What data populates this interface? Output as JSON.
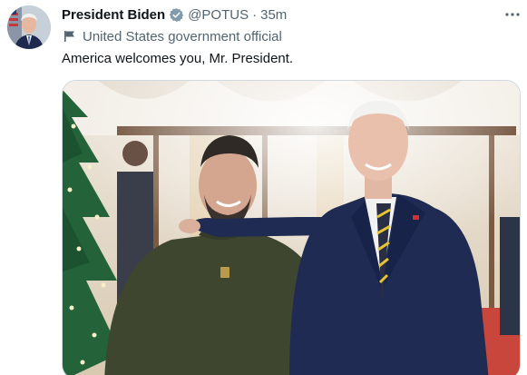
{
  "tweet": {
    "author_name": "President Biden",
    "handle": "@POTUS",
    "separator": "·",
    "timestamp": "35m",
    "verified": true,
    "affiliation_label": "United States government official",
    "text": "America welcomes you, Mr. President.",
    "more_icon": "more-horizontal-icon",
    "affiliation_icon": "flag-icon",
    "verified_icon": "verified-badge-icon",
    "media_alt": ""
  },
  "colors": {
    "verified_badge": "#829aab",
    "secondary_text": "#536471",
    "primary_text": "#0f1419",
    "media_border": "#cfd9de"
  }
}
